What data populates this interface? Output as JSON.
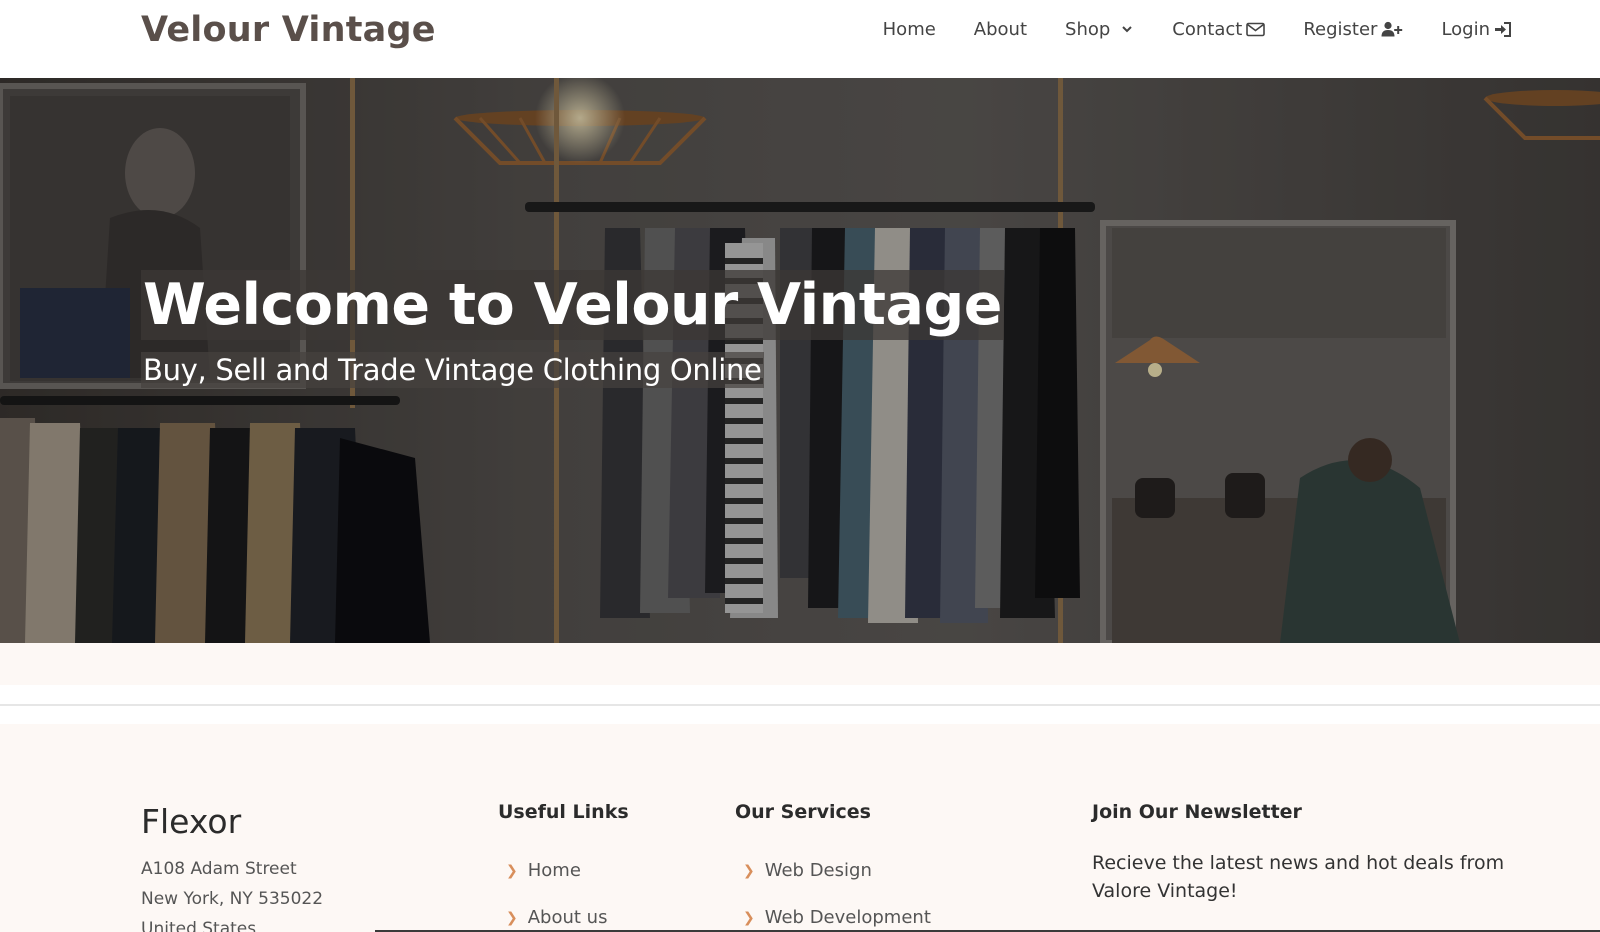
{
  "header": {
    "brand": "Velour Vintage",
    "nav": [
      {
        "label": "Home",
        "icon": ""
      },
      {
        "label": "About",
        "icon": ""
      },
      {
        "label": "Shop",
        "icon": "chevron-down-icon"
      },
      {
        "label": "Contact",
        "icon": "envelope-icon"
      },
      {
        "label": "Register",
        "icon": "user-plus-icon"
      },
      {
        "label": "Login",
        "icon": "sign-in-icon"
      }
    ]
  },
  "hero": {
    "title": "Welcome to Velour Vintage",
    "subtitle": "Buy, Sell and Trade Vintage Clothing Online"
  },
  "footer": {
    "brand": "Flexor",
    "address": [
      "A108 Adam Street",
      "New York, NY 535022",
      "United States"
    ],
    "useful_links": {
      "heading": "Useful Links",
      "items": [
        "Home",
        "About us"
      ]
    },
    "services": {
      "heading": "Our Services",
      "items": [
        "Web Design",
        "Web Development"
      ]
    },
    "newsletter": {
      "heading": "Join Our Newsletter",
      "text": "Recieve the latest news and hot deals from Valore Vintage!"
    }
  },
  "colors": {
    "brand_text": "#5a4f4a",
    "accent": "#d88e5b",
    "footer_bg": "#fdf8f5"
  }
}
